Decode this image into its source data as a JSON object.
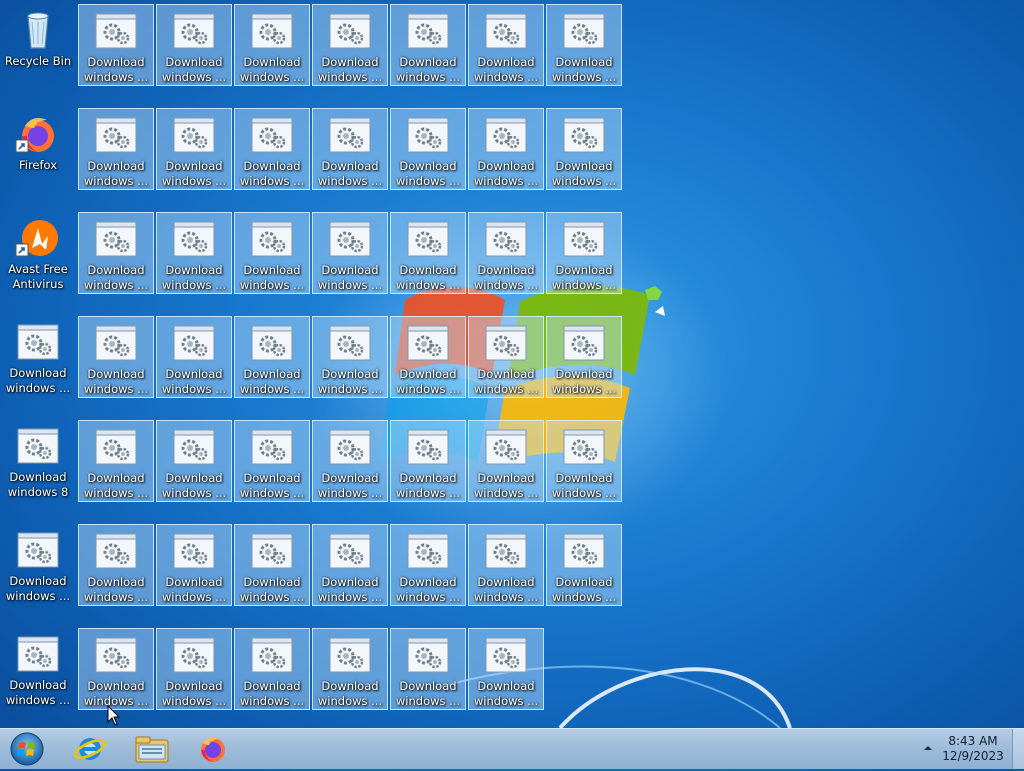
{
  "desktop": {
    "icons": [
      {
        "label": "Recycle Bin",
        "icon": "recycle-bin-icon",
        "kind": "recycle"
      },
      {
        "label": "Firefox",
        "icon": "firefox-icon",
        "kind": "firefox",
        "shortcut": true
      },
      {
        "label": "Avast Free\nAntivirus",
        "icon": "avast-icon",
        "kind": "avast",
        "shortcut": true
      },
      {
        "label": "Download\nwindows ...",
        "icon": "setup-file-icon",
        "kind": "setup"
      },
      {
        "label": "Download\nwindows 8",
        "icon": "setup-file-icon",
        "kind": "setup"
      },
      {
        "label": "Download\nwindows ...",
        "icon": "setup-file-icon",
        "kind": "setup"
      },
      {
        "label": "Download\nwindows ...",
        "icon": "setup-file-icon",
        "kind": "setup"
      }
    ],
    "grid_label": "Download\nwindows ...",
    "grid_rows": [
      7,
      7,
      7,
      7,
      7,
      7,
      6
    ]
  },
  "taskbar": {
    "start": "start-orb-icon",
    "pinned": [
      {
        "name": "internet-explorer-icon"
      },
      {
        "name": "file-explorer-icon"
      },
      {
        "name": "firefox-icon"
      }
    ],
    "time": "8:43 AM",
    "date": "12/9/2023"
  },
  "colors": {
    "accent": "#1878cf",
    "taskbar": "#9fbcd9",
    "selection": "#bee1fa"
  }
}
